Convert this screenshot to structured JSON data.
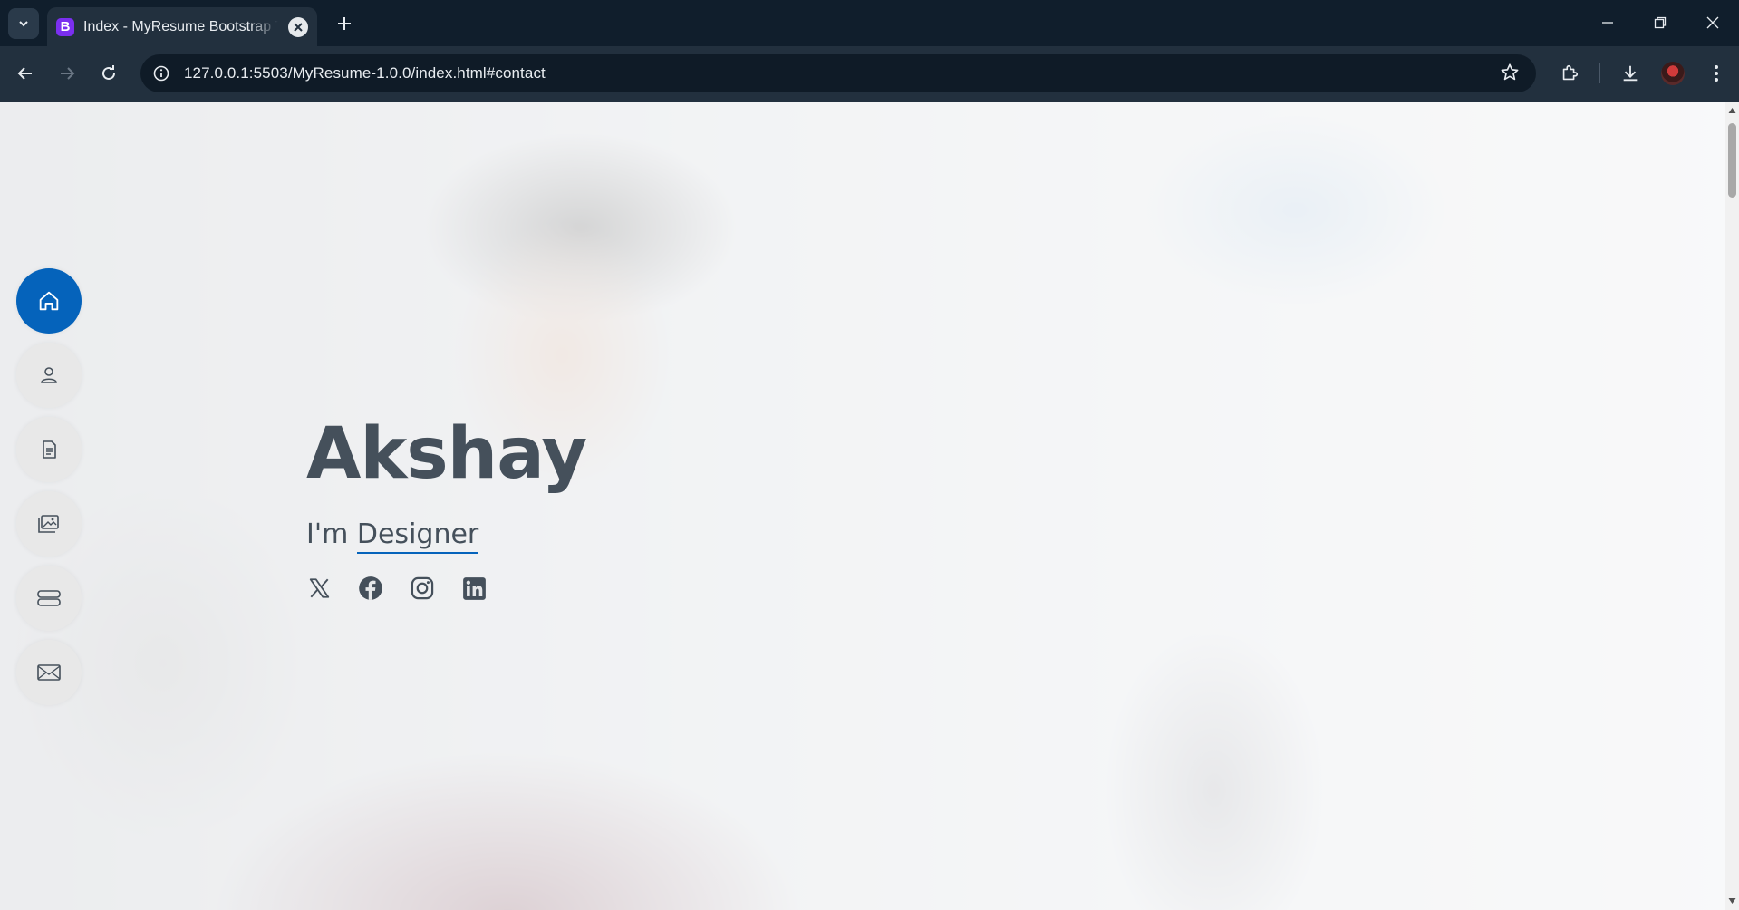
{
  "browser": {
    "tab": {
      "favicon_letter": "B",
      "title": "Index - MyResume Bootstrap Template"
    },
    "address": {
      "url": "127.0.0.1:5503/MyResume-1.0.0/index.html#contact"
    }
  },
  "hero": {
    "name": "Akshay",
    "prefix": "I'm",
    "typed": "Designer"
  },
  "nav": {
    "items": [
      {
        "icon": "house-icon",
        "active": true
      },
      {
        "icon": "person-icon",
        "active": false
      },
      {
        "icon": "file-text-icon",
        "active": false
      },
      {
        "icon": "images-icon",
        "active": false
      },
      {
        "icon": "server-icon",
        "active": false
      },
      {
        "icon": "envelope-icon",
        "active": false
      }
    ]
  },
  "socials": [
    "x-icon",
    "facebook-icon",
    "instagram-icon",
    "linkedin-icon"
  ],
  "colors": {
    "accent": "#0563bb",
    "heading": "#45505b",
    "chrome_dark": "#101e2c",
    "chrome_toolbar": "#22303e"
  }
}
